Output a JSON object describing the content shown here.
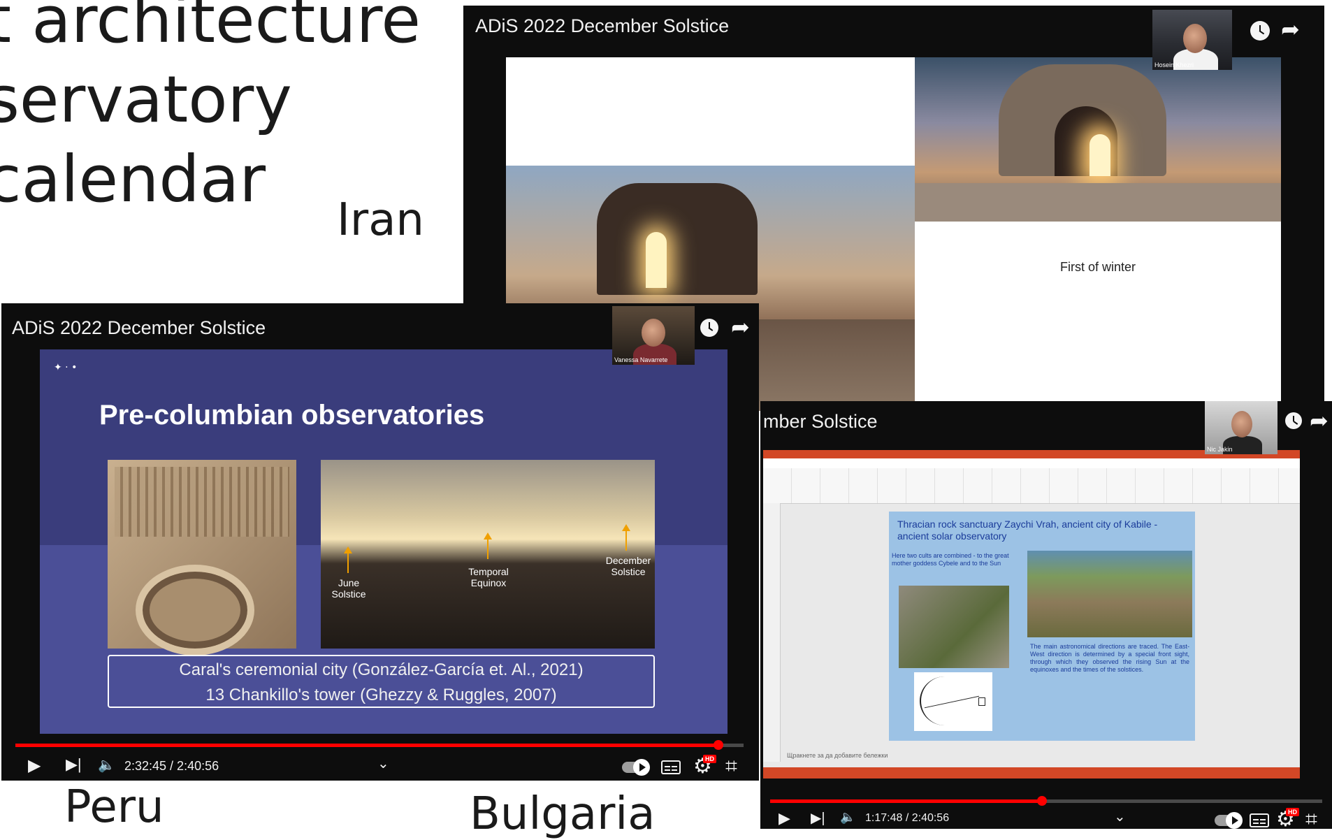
{
  "headline": {
    "line1": "t architecture",
    "line2": "servatory",
    "line3": "calendar"
  },
  "countries": {
    "iran": "Iran",
    "peru": "Peru",
    "bulgaria": "Bulgaria"
  },
  "window_iran": {
    "title": "ADiS 2022 December Solstice",
    "presenter": "Hosein Khezri",
    "slide_caption": "First of winter"
  },
  "window_peru": {
    "title": "ADiS 2022 December Solstice",
    "presenter": "Vanessa Navarrete",
    "slide_title": "Pre-columbian observatories",
    "label_june": "June\nSolstice",
    "label_temporal": "Temporal\nEquinox",
    "label_december": "December\nSolstice",
    "caption_line1": "Caral's ceremonial city (González-García et. Al., 2021)",
    "caption_line2": "13 Chankillo's tower (Ghezzy & Ruggles, 2007)",
    "time": "2:32:45 / 2:40:56",
    "progress": 0.965
  },
  "window_bulgaria": {
    "title": "mber Solstice",
    "presenter": "Nic Jakin",
    "ppt_title": "Thracian rock sanctuary Zaychi Vrah, ancient city of Kabile - ancient solar observatory",
    "ppt_text1": "Here two cults are combined - to the great mother goddess Cybele and to the Sun",
    "ppt_text2": "The main astronomical directions are traced. The East-West direction is determined by a special front sight, through which they observed the rising Sun at the equinoxes and the times of the solstices.",
    "notes_hint": "Щракнете за да добавите бележки",
    "time": "1:17:48 / 2:40:56",
    "progress": 0.492
  },
  "colors": {
    "slide_purple": "#3a3d7c",
    "progress_red": "#ff0000",
    "ppt_red": "#d24726",
    "ppt_blue_box": "#9cc2e5"
  },
  "icons": [
    "clock-icon",
    "share-icon",
    "play-icon",
    "next-icon",
    "volume-icon",
    "chevron-down-icon",
    "autoplay-toggle",
    "captions-icon",
    "settings-icon",
    "exit-fullscreen-icon"
  ]
}
